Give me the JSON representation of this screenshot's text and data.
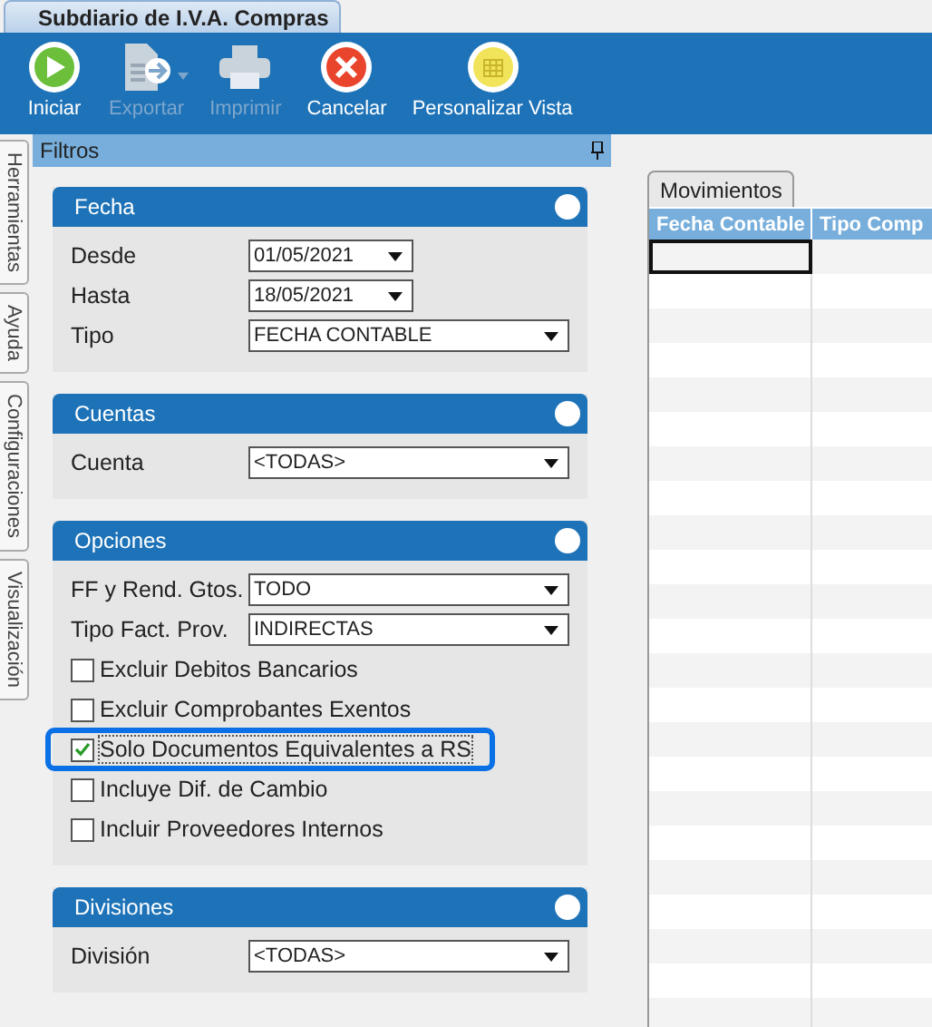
{
  "window": {
    "title": "Subdiario de I.V.A. Compras"
  },
  "toolbar": [
    {
      "label": "Iniciar",
      "kind": "play",
      "disabled": false,
      "dropdown": false
    },
    {
      "label": "Exportar",
      "kind": "export",
      "disabled": true,
      "dropdown": true
    },
    {
      "label": "Imprimir",
      "kind": "print",
      "disabled": true,
      "dropdown": false
    },
    {
      "label": "Cancelar",
      "kind": "cancel",
      "disabled": false,
      "dropdown": false
    },
    {
      "label": "Personalizar Vista",
      "kind": "grid",
      "disabled": false,
      "dropdown": false
    }
  ],
  "side_tabs": [
    {
      "label": "Herramientas"
    },
    {
      "label": "Ayuda"
    },
    {
      "label": "Configuraciones"
    },
    {
      "label": "Visualización"
    }
  ],
  "filter_panel": {
    "title": "Filtros",
    "sections": [
      {
        "title": "Fecha",
        "fields": [
          {
            "kind": "date",
            "label": "Desde",
            "value": "01/05/2021"
          },
          {
            "kind": "date",
            "label": "Hasta",
            "value": "18/05/2021"
          },
          {
            "kind": "select",
            "label": "Tipo",
            "value": "FECHA CONTABLE"
          }
        ]
      },
      {
        "title": "Cuentas",
        "fields": [
          {
            "kind": "select",
            "label": "Cuenta",
            "value": "<TODAS>"
          }
        ]
      },
      {
        "title": "Opciones",
        "fields": [
          {
            "kind": "select",
            "label": "FF y Rend. Gtos.",
            "value": "TODO"
          },
          {
            "kind": "select",
            "label": "Tipo Fact. Prov.",
            "value": "INDIRECTAS"
          },
          {
            "kind": "checkbox",
            "label": "Excluir Debitos Bancarios",
            "checked": false,
            "focused": false
          },
          {
            "kind": "checkbox",
            "label": "Excluir Comprobantes Exentos",
            "checked": false,
            "focused": false
          },
          {
            "kind": "checkbox",
            "label": "Solo Documentos Equivalentes a RS",
            "checked": true,
            "focused": true
          },
          {
            "kind": "checkbox",
            "label": "Incluye Dif. de Cambio",
            "checked": false,
            "focused": false
          },
          {
            "kind": "checkbox",
            "label": "Incluir Proveedores Internos",
            "checked": false,
            "focused": false
          }
        ]
      },
      {
        "title": "Divisiones",
        "fields": [
          {
            "kind": "select",
            "label": "División",
            "value": "<TODAS>"
          }
        ]
      }
    ]
  },
  "grid": {
    "tab": "Movimientos",
    "columns": [
      "Fecha Contable",
      "Tipo Comp"
    ]
  }
}
